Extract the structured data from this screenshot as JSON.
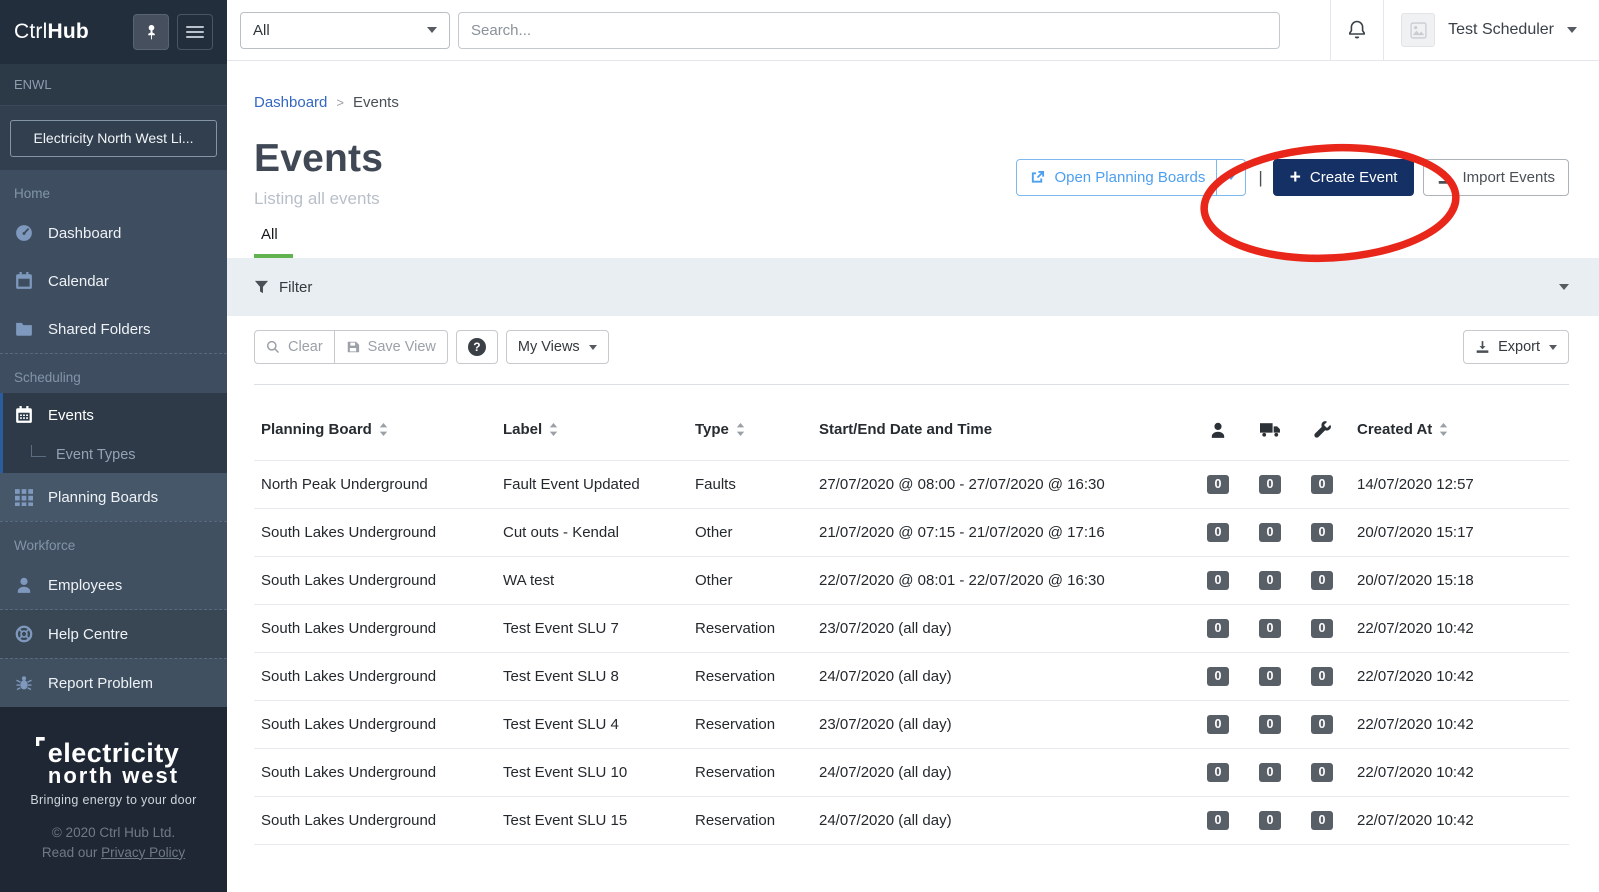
{
  "brand": {
    "name_prefix": "Ctrl",
    "name_suffix": "Hub"
  },
  "topbar": {
    "scope_selected": "All",
    "search_placeholder": "Search...",
    "user_name": "Test Scheduler"
  },
  "sidebar": {
    "org_code": "ENWL",
    "org_button": "Electricity North West Li...",
    "sections": [
      {
        "label": "Home",
        "items": [
          {
            "label": "Dashboard"
          },
          {
            "label": "Calendar"
          },
          {
            "label": "Shared Folders"
          }
        ]
      },
      {
        "label": "Scheduling",
        "items": [
          {
            "label": "Events"
          },
          {
            "label": "Event Types"
          },
          {
            "label": "Planning Boards"
          }
        ]
      },
      {
        "label": "Workforce",
        "items": [
          {
            "label": "Employees"
          }
        ]
      }
    ],
    "utility": [
      {
        "label": "Help Centre"
      },
      {
        "label": "Report Problem"
      }
    ],
    "footer": {
      "logo_line1": "electricity",
      "logo_line2": "north west",
      "tagline": "Bringing energy to your door",
      "copyright": "© 2020 Ctrl Hub Ltd.",
      "read_our": "Read our ",
      "privacy_link": "Privacy Policy"
    }
  },
  "breadcrumb": {
    "parent": "Dashboard",
    "separator": ">",
    "current": "Events"
  },
  "page": {
    "title": "Events",
    "subtitle": "Listing all events"
  },
  "actions": {
    "open_planning_boards": "Open Planning Boards",
    "create_event": "Create Event",
    "import_events": "Import Events"
  },
  "tabs": {
    "all": "All"
  },
  "filter_bar": {
    "label": "Filter"
  },
  "view_toolbar": {
    "clear": "Clear",
    "save_view": "Save View",
    "help": "?",
    "my_views": "My Views",
    "export": "Export"
  },
  "table": {
    "headers": {
      "planning_board": "Planning Board",
      "label": "Label",
      "type": "Type",
      "start_end": "Start/End Date and Time",
      "created_at": "Created At"
    },
    "icon_columns": [
      "person-icon",
      "truck-icon",
      "wrench-icon"
    ],
    "rows": [
      {
        "planning_board": "North Peak Underground",
        "label": "Fault Event Updated",
        "type": "Faults",
        "start_end": "27/07/2020 @ 08:00 - 27/07/2020 @ 16:30",
        "counts": [
          "0",
          "0",
          "0"
        ],
        "created_at": "14/07/2020 12:57"
      },
      {
        "planning_board": "South Lakes Underground",
        "label": "Cut outs - Kendal",
        "type": "Other",
        "start_end": "21/07/2020 @ 07:15 - 21/07/2020 @ 17:16",
        "counts": [
          "0",
          "0",
          "0"
        ],
        "created_at": "20/07/2020 15:17"
      },
      {
        "planning_board": "South Lakes Underground",
        "label": "WA test",
        "type": "Other",
        "start_end": "22/07/2020 @ 08:01 - 22/07/2020 @ 16:30",
        "counts": [
          "0",
          "0",
          "0"
        ],
        "created_at": "20/07/2020 15:18"
      },
      {
        "planning_board": "South Lakes Underground",
        "label": "Test Event SLU 7",
        "type": "Reservation",
        "start_end": "23/07/2020 (all day)",
        "counts": [
          "0",
          "0",
          "0"
        ],
        "created_at": "22/07/2020 10:42"
      },
      {
        "planning_board": "South Lakes Underground",
        "label": "Test Event SLU 8",
        "type": "Reservation",
        "start_end": "24/07/2020 (all day)",
        "counts": [
          "0",
          "0",
          "0"
        ],
        "created_at": "22/07/2020 10:42"
      },
      {
        "planning_board": "South Lakes Underground",
        "label": "Test Event SLU 4",
        "type": "Reservation",
        "start_end": "23/07/2020 (all day)",
        "counts": [
          "0",
          "0",
          "0"
        ],
        "created_at": "22/07/2020 10:42"
      },
      {
        "planning_board": "South Lakes Underground",
        "label": "Test Event SLU 10",
        "type": "Reservation",
        "start_end": "24/07/2020 (all day)",
        "counts": [
          "0",
          "0",
          "0"
        ],
        "created_at": "22/07/2020 10:42"
      },
      {
        "planning_board": "South Lakes Underground",
        "label": "Test Event SLU 15",
        "type": "Reservation",
        "start_end": "24/07/2020 (all day)",
        "counts": [
          "0",
          "0",
          "0"
        ],
        "created_at": "22/07/2020 10:42"
      }
    ]
  },
  "annotation": {
    "shape": "hand-drawn red ellipse around Create Event button",
    "color": "#e8261a"
  },
  "colors": {
    "brand_navy": "#143065",
    "tab_green": "#61b350",
    "link_blue": "#3468c0",
    "annotation_red": "#e8261a",
    "filter_bg": "#e9eef3",
    "sidebar_dark": "#232e3c",
    "badge_gray": "#585f66"
  }
}
